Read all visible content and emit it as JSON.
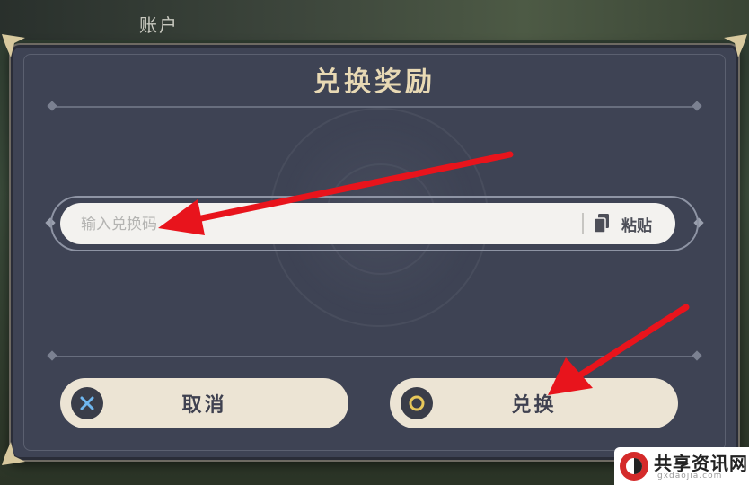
{
  "background": {
    "account_label": "账户"
  },
  "dialog": {
    "title": "兑换奖励",
    "input": {
      "placeholder": "输入兑换码",
      "value": ""
    },
    "paste_label": "粘贴",
    "cancel_label": "取消",
    "redeem_label": "兑换"
  },
  "watermark": {
    "name": "共享资讯网",
    "domain": "gxdaojia.com"
  },
  "colors": {
    "dialog_bg": "#3e4354",
    "title_gold": "#e8d9b4",
    "button_bg": "#ece4d4",
    "arrow_red": "#e8141c"
  }
}
